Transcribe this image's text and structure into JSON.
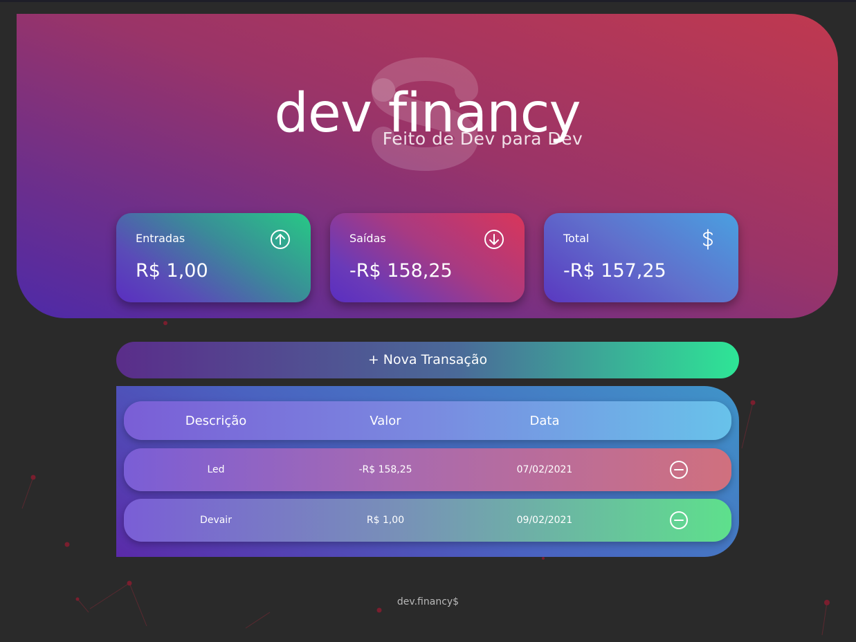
{
  "header": {
    "app_title": "dev financy",
    "subtitle": "Feito de Dev para Dev",
    "background_icon": "dollar-sign-icon"
  },
  "cards": {
    "income": {
      "label": "Entradas",
      "value": "R$ 1,00",
      "icon": "arrow-up-circle-icon"
    },
    "expense": {
      "label": "Saídas",
      "value": "-R$ 158,25",
      "icon": "arrow-down-circle-icon"
    },
    "total": {
      "label": "Total",
      "value": "-R$ 157,25",
      "icon": "dollar-sign-icon"
    }
  },
  "new_transaction": {
    "label": "+ Nova Transação"
  },
  "table": {
    "columns": [
      "Descrição",
      "Valor",
      "Data"
    ],
    "rows": [
      {
        "description": "Led",
        "amount": "-R$ 158,25",
        "date": "07/02/2021",
        "remove_icon": "minus-circle-icon"
      },
      {
        "description": "Devair",
        "amount": "R$ 1,00",
        "date": "09/02/2021",
        "remove_icon": "minus-circle-icon"
      }
    ]
  },
  "footer": {
    "text": "dev.financy$"
  },
  "colors": {
    "page_background": "#2a2a2a",
    "header_gradient_start": "#c0394f",
    "header_gradient_end": "#4e2aa8",
    "income_accent": "#27c985",
    "expense_accent": "#d9365a",
    "total_accent": "#4aa0e0"
  }
}
